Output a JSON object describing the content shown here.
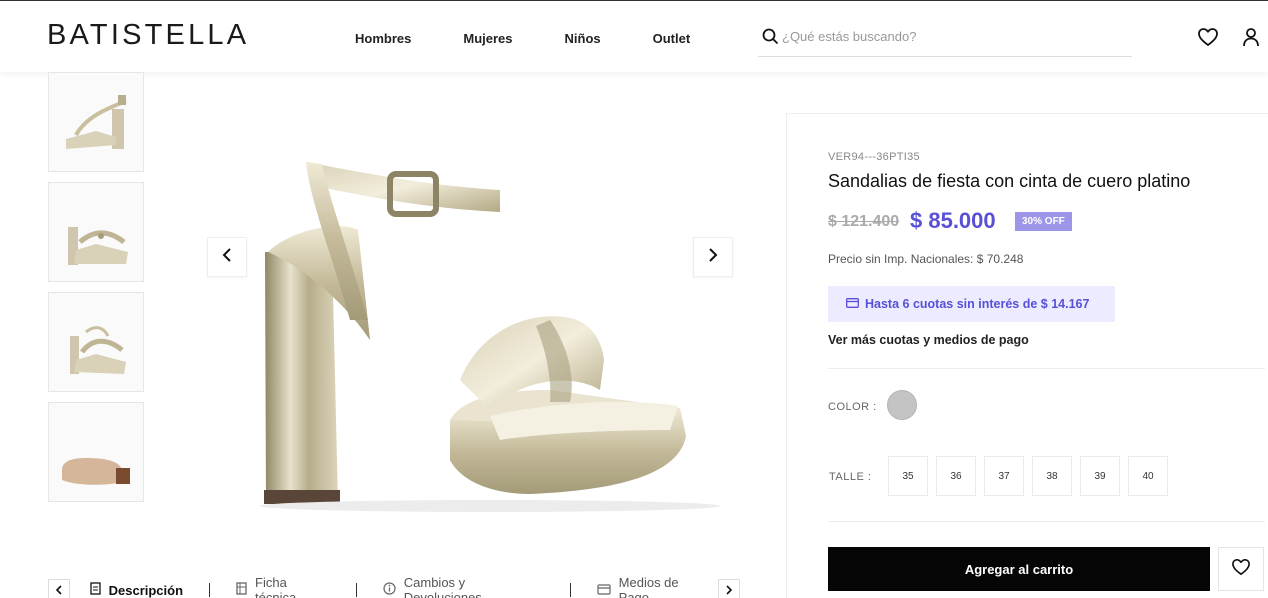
{
  "header": {
    "logo": "BATISTELLA",
    "nav": [
      "Hombres",
      "Mujeres",
      "Niños",
      "Outlet"
    ],
    "search_placeholder": "¿Qué estás buscando?",
    "icons": [
      "search-icon",
      "heart-icon",
      "user-icon"
    ]
  },
  "gallery": {
    "thumbnail_count": 4,
    "prev_icon": "chevron-left-icon",
    "next_icon": "chevron-right-icon"
  },
  "tabs": {
    "items": [
      {
        "label": "Descripción",
        "icon": "document-icon",
        "active": true
      },
      {
        "label": "Ficha técnica",
        "icon": "sheet-icon",
        "active": false
      },
      {
        "label": "Cambios y Devoluciones",
        "icon": "info-icon",
        "active": false
      },
      {
        "label": "Medios de Pago",
        "icon": "card-icon",
        "active": false
      }
    ]
  },
  "product": {
    "sku": "VER94---36PTI35",
    "title": "Sandalias de fiesta con cinta de cuero platino",
    "old_price": "$ 121.400",
    "price": "$ 85.000",
    "discount": "30% OFF",
    "price_no_tax": "Precio sin Imp. Nacionales: $ 70.248",
    "installments": "Hasta 6 cuotas sin interés de $ 14.167",
    "more_payment": "Ver más cuotas y medios de pago",
    "color_label": "COLOR :",
    "color_swatch": "#c4c4c4",
    "size_label": "TALLE :",
    "sizes": [
      "35",
      "36",
      "37",
      "38",
      "39",
      "40"
    ],
    "add_to_cart": "Agregar al carrito"
  },
  "colors": {
    "accent": "#5850d6",
    "accent_light": "#ecebff",
    "badge": "#9d96e8",
    "button": "#050505"
  }
}
